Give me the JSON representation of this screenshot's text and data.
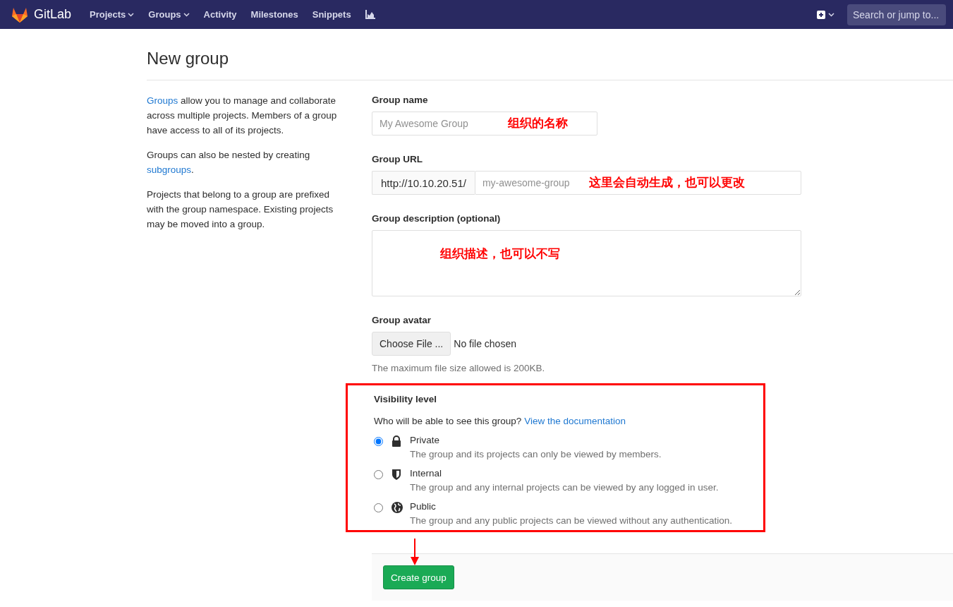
{
  "navbar": {
    "brand": "GitLab",
    "items": [
      {
        "label": "Projects",
        "dropdown": true
      },
      {
        "label": "Groups",
        "dropdown": true
      },
      {
        "label": "Activity",
        "dropdown": false
      },
      {
        "label": "Milestones",
        "dropdown": false
      },
      {
        "label": "Snippets",
        "dropdown": false
      }
    ],
    "search": {
      "placeholder": "Search or jump to..."
    }
  },
  "title": "New group",
  "help": [
    [
      {
        "text": "Groups",
        "link": true
      },
      {
        "text": " allow you to manage and collaborate across multiple projects. Members of a group have access to all of its projects.",
        "link": false
      }
    ],
    [
      {
        "text": "Groups can also be nested by creating ",
        "link": false
      },
      {
        "text": "subgroups",
        "link": true
      },
      {
        "text": ".",
        "link": false
      }
    ],
    [
      {
        "text": "Projects that belong to a group are prefixed with the group namespace. Existing projects may be moved into a group.",
        "link": false
      }
    ]
  ],
  "name_field": {
    "label": "Group name",
    "placeholder": "My Awesome Group",
    "annotation": "组织的名称"
  },
  "url_field": {
    "label": "Group URL",
    "prefix": "http://10.10.20.51/",
    "placeholder": "my-awesome-group",
    "annotation": "这里会自动生成，也可以更改"
  },
  "description_field": {
    "label": "Group description (optional)",
    "annotation": "组织描述，也可以不写"
  },
  "avatar": {
    "label": "Group avatar",
    "button": "Choose File ...",
    "status": "No file chosen",
    "hint": "The maximum file size allowed is 200KB."
  },
  "visibility": {
    "highlighted": true,
    "label": "Visibility level",
    "question": "Who will be able to see this group?",
    "link": "View the documentation",
    "options": [
      {
        "kind": "lock",
        "label": "Private",
        "description": "The group and its projects can only be viewed by members.",
        "selected": true
      },
      {
        "kind": "shield",
        "label": "Internal",
        "description": "The group and any internal projects can be viewed by any logged in user.",
        "selected": false
      },
      {
        "kind": "globe",
        "label": "Public",
        "description": "The group and any public projects can be viewed without any authentication.",
        "selected": false
      }
    ]
  },
  "footer": {
    "arrow": true,
    "button": "Create group"
  }
}
